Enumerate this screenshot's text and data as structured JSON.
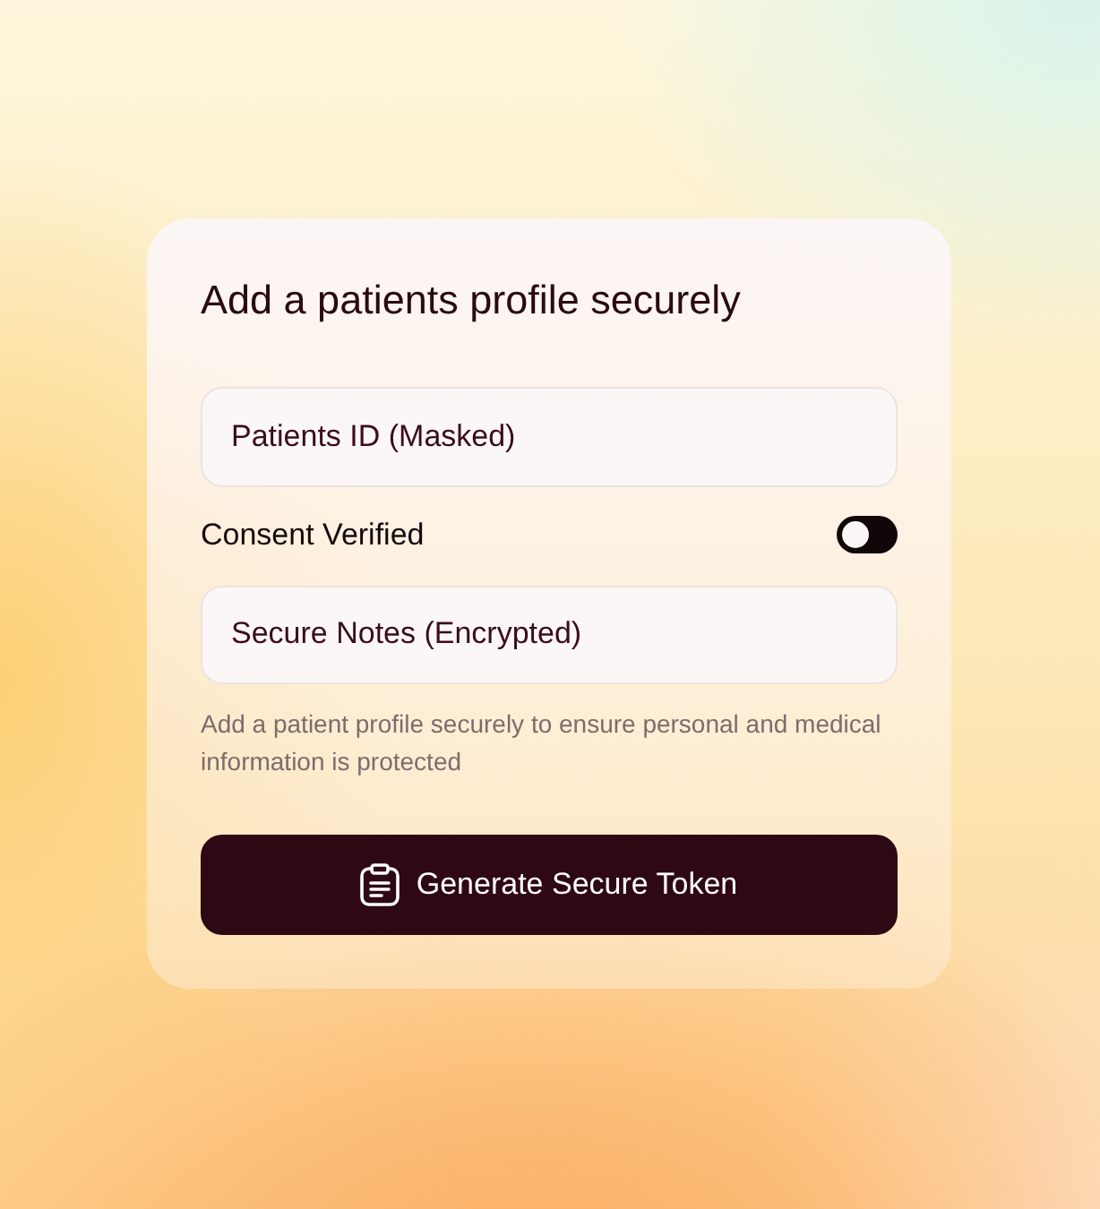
{
  "card": {
    "title": "Add a patients profile securely",
    "patient_id_field": {
      "placeholder": "Patients ID (Masked)"
    },
    "consent": {
      "label": "Consent Verified",
      "on": false
    },
    "notes_field": {
      "placeholder": "Secure Notes (Encrypted)"
    },
    "helper_text": "Add a patient profile securely to ensure personal and medical information is protected",
    "button": {
      "label": "Generate Secure Token"
    }
  }
}
